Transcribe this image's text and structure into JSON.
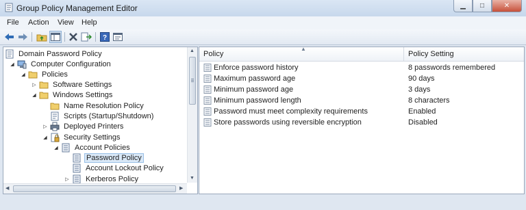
{
  "window": {
    "title": "Group Policy Management Editor",
    "icon": "policy-editor-icon"
  },
  "window_controls": {
    "minimize": "minimize-icon",
    "maximize": "maximize-icon",
    "close": "close-icon"
  },
  "menu": {
    "items": [
      "File",
      "Action",
      "View",
      "Help"
    ]
  },
  "toolbar": {
    "buttons": [
      "back-arrow-icon",
      "forward-arrow-icon",
      "up-folder-icon",
      "show-hide-tree-icon",
      "delete-icon",
      "export-list-icon",
      "help-icon",
      "properties-icon"
    ]
  },
  "tree": {
    "items": [
      {
        "label": "Domain Password Policy",
        "icon": "policy-document-icon",
        "toggle": ""
      },
      {
        "label": "Computer Configuration",
        "icon": "computer-icon",
        "toggle": "▲"
      },
      {
        "label": "Policies",
        "icon": "folder-icon",
        "toggle": "▲"
      },
      {
        "label": "Software Settings",
        "icon": "folder-icon",
        "toggle": "▷"
      },
      {
        "label": "Windows Settings",
        "icon": "folder-icon",
        "toggle": "▲"
      },
      {
        "label": "Name Resolution Policy",
        "icon": "folder-icon",
        "toggle": ""
      },
      {
        "label": "Scripts (Startup/Shutdown)",
        "icon": "script-icon",
        "toggle": ""
      },
      {
        "label": "Deployed Printers",
        "icon": "printer-icon",
        "toggle": "▷"
      },
      {
        "label": "Security Settings",
        "icon": "security-icon",
        "toggle": "▲"
      },
      {
        "label": "Account Policies",
        "icon": "policy-icon",
        "toggle": "▲"
      },
      {
        "label": "Password Policy",
        "icon": "policy-icon",
        "toggle": "",
        "selected": true
      },
      {
        "label": "Account Lockout Policy",
        "icon": "policy-icon",
        "toggle": ""
      },
      {
        "label": "Kerberos Policy",
        "icon": "policy-icon",
        "toggle": "▷"
      }
    ]
  },
  "list": {
    "columns": [
      "Policy",
      "Policy Setting"
    ],
    "rows": [
      {
        "policy": "Enforce password history",
        "setting": "8 passwords remembered"
      },
      {
        "policy": "Maximum password age",
        "setting": "90 days"
      },
      {
        "policy": "Minimum password age",
        "setting": "3 days"
      },
      {
        "policy": "Minimum password length",
        "setting": "8 characters"
      },
      {
        "policy": "Password must meet complexity requirements",
        "setting": "Enabled"
      },
      {
        "policy": "Store passwords using reversible encryption",
        "setting": "Disabled"
      }
    ]
  },
  "colors": {
    "selection": "#d9e8f7",
    "folder": "#e8c35a",
    "accent": "#2f6cb5"
  }
}
